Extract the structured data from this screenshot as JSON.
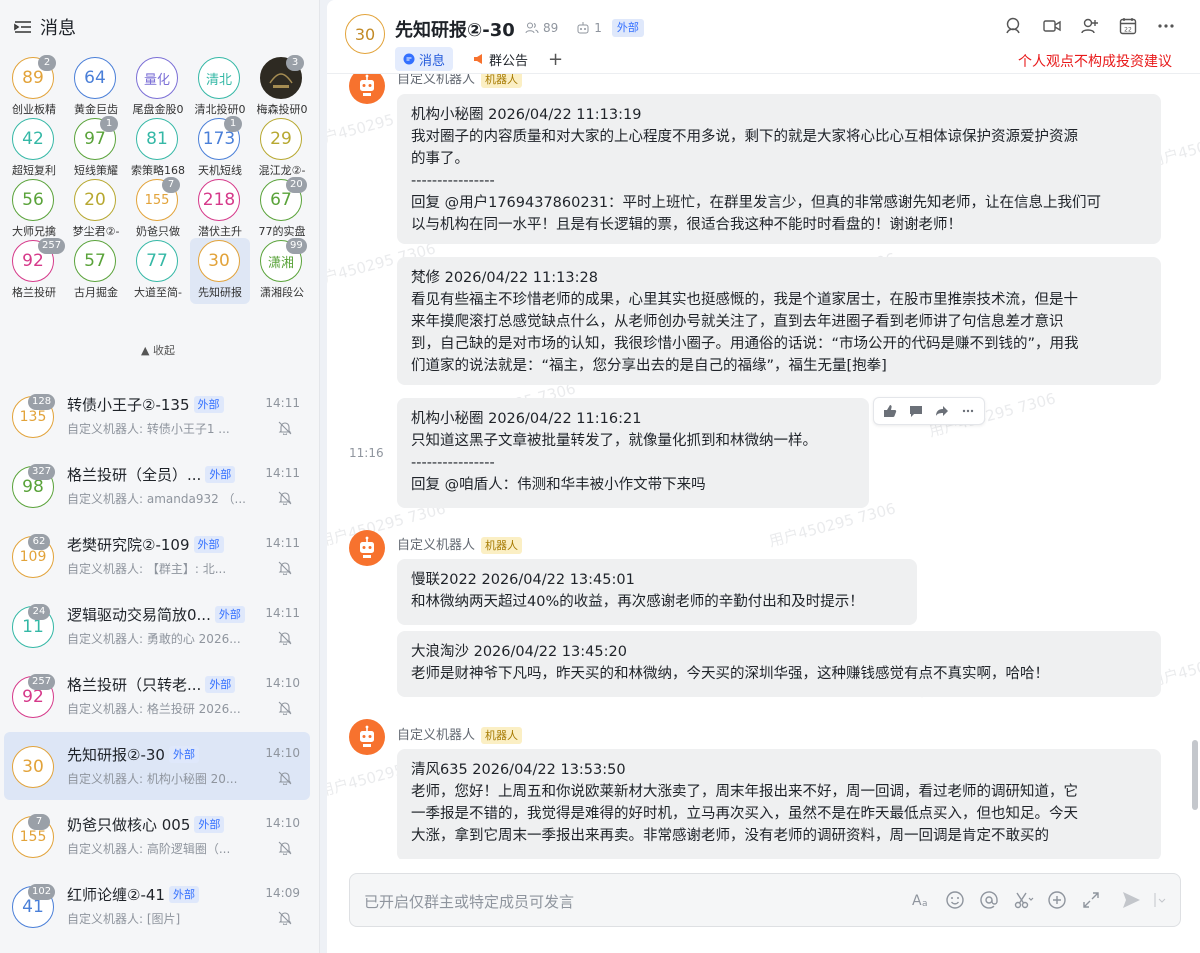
{
  "sidebar": {
    "title": "消息",
    "grid": [
      {
        "text": "89",
        "label": "创业板精",
        "badge": "2",
        "color": "#e2a33a",
        "small": false
      },
      {
        "text": "64",
        "label": "黄金巨齿",
        "badge": "",
        "color": "#4a7fd8",
        "small": false
      },
      {
        "text": "量化",
        "label": "尾盘金股0",
        "badge": "",
        "color": "#7b6fd6",
        "small": true
      },
      {
        "text": "清北",
        "label": "清北投研0",
        "badge": "",
        "color": "#35b8a6",
        "small": true
      },
      {
        "text": "",
        "label": "梅森投研0",
        "badge": "3",
        "color": "#2e2a22",
        "small": false
      },
      {
        "text": "42",
        "label": "超短复利",
        "badge": "",
        "color": "#35b8a6",
        "small": false
      },
      {
        "text": "97",
        "label": "短线策耀",
        "badge": "1",
        "color": "#5aa33a",
        "small": false
      },
      {
        "text": "81",
        "label": "索策略168",
        "badge": "",
        "color": "#35b8a6",
        "small": false
      },
      {
        "text": "173",
        "label": "天机短线",
        "badge": "1",
        "color": "#4a7fd8",
        "small": false
      },
      {
        "text": "29",
        "label": "混江龙②-",
        "badge": "",
        "color": "#b7a830",
        "small": false
      },
      {
        "text": "56",
        "label": "大师兄擒",
        "badge": "",
        "color": "#5aa33a",
        "small": false
      },
      {
        "text": "20",
        "label": "梦尘君②-",
        "badge": "",
        "color": "#b7a830",
        "small": false
      },
      {
        "text": "155",
        "label": "奶爸只做",
        "badge": "7",
        "color": "#e2a33a",
        "small": true
      },
      {
        "text": "218",
        "label": "潜伏主升",
        "badge": "",
        "color": "#d6398a",
        "small": false
      },
      {
        "text": "67",
        "label": "77的实盘",
        "badge": "20",
        "color": "#5aa33a",
        "small": false
      },
      {
        "text": "92",
        "label": "格兰投研",
        "badge": "257",
        "color": "#d6398a",
        "small": false
      },
      {
        "text": "57",
        "label": "古月掘金",
        "badge": "",
        "color": "#5aa33a",
        "small": false
      },
      {
        "text": "77",
        "label": "大道至简-",
        "badge": "",
        "color": "#35b8a6",
        "small": false
      },
      {
        "text": "30",
        "label": "先知研报",
        "badge": "",
        "color": "#e2a33a",
        "small": false
      },
      {
        "text": "潇湘",
        "label": "潇湘段公",
        "badge": "99",
        "color": "#5aa33a",
        "small": true
      }
    ],
    "collapse_label": "▲ 收起",
    "chats": [
      {
        "avatar": "135",
        "badge": "128",
        "color": "#e2a33a",
        "name": "转债小王子②-135",
        "tag": "外部",
        "time": "14:11",
        "preview": "自定义机器人: 转债小王子1 ...",
        "small": true
      },
      {
        "avatar": "98",
        "badge": "327",
        "color": "#5aa33a",
        "name": "格兰投研（全员）...",
        "tag": "外部",
        "time": "14:11",
        "preview": "自定义机器人: amanda932 （...",
        "small": false
      },
      {
        "avatar": "109",
        "badge": "62",
        "color": "#e2a33a",
        "name": "老樊研究院②-109",
        "tag": "外部",
        "time": "14:11",
        "preview": "自定义机器人: 【群主】: 北...",
        "small": true
      },
      {
        "avatar": "11",
        "badge": "24",
        "color": "#35b8a6",
        "name": "逻辑驱动交易简放0...",
        "tag": "外部",
        "time": "14:11",
        "preview": "自定义机器人: 勇敢的心 2026...",
        "small": false
      },
      {
        "avatar": "92",
        "badge": "257",
        "color": "#d6398a",
        "name": "格兰投研（只转老...",
        "tag": "外部",
        "time": "14:10",
        "preview": "自定义机器人: 格兰投研 2026...",
        "small": false
      },
      {
        "avatar": "30",
        "badge": "",
        "color": "#e2a33a",
        "name": "先知研报②-30",
        "tag": "外部",
        "time": "14:10",
        "preview": "自定义机器人: 机构小秘圈 20...",
        "small": false
      },
      {
        "avatar": "155",
        "badge": "7",
        "color": "#e2a33a",
        "name": "奶爸只做核心 005",
        "tag": "外部",
        "time": "14:10",
        "preview": "自定义机器人: 高阶逻辑圈（...",
        "small": true
      },
      {
        "avatar": "41",
        "badge": "102",
        "color": "#4a7fd8",
        "name": "红师论缠②-41",
        "tag": "外部",
        "time": "14:09",
        "preview": "自定义机器人: [图片]",
        "small": false
      }
    ]
  },
  "header": {
    "avatar": "30",
    "title": "先知研报②-30",
    "members": "89",
    "bots": "1",
    "external_tag": "外部",
    "tabs": [
      "消息",
      "群公告"
    ],
    "disclaimer": "个人观点不构成投资建议"
  },
  "messages": {
    "sender_name": "自定义机器人",
    "bot_tag": "机器人",
    "side_time": "11:16",
    "bubbles": [
      {
        "lines": [
          "机构小秘圈 2026/04/22 11:13:19",
          "我对圈子的内容质量和对大家的上心程度不用多说，剩下的就是大家将心比心互相体谅保护资源爱护资源",
          "的事了。",
          "----------------",
          "回复 @用户1769437860231：平时上班忙，在群里发言少，但真的非常感谢先知老师，让在信息上我们可",
          "以与机构在同一水平！且是有长逻辑的票，很适合我这种不能时时看盘的！谢谢老师！"
        ]
      },
      {
        "lines": [
          "梵修 2026/04/22 11:13:28",
          "看见有些福主不珍惜老师的成果，心里其实也挺感慨的，我是个道家居士，在股市里推崇技术流，但是十",
          "来年摸爬滚打总感觉缺点什么，从老师创办号就关注了，直到去年进圈子看到老师讲了句信息差才意识",
          "到，自己缺的是对市场的认知，我很珍惜小圈子。用通俗的话说：“市场公开的代码是赚不到钱的”，用我",
          "们道家的说法就是：“福主，您分享出去的是自己的福缘”，福生无量[抱拳]"
        ]
      },
      {
        "lines": [
          "机构小秘圈 2026/04/22 11:16:21",
          "只知道这黑子文章被批量转发了，就像量化抓到和林微纳一样。",
          "----------------",
          "回复 @咱盾人：伟测和华丰被小作文带下来吗"
        ]
      },
      {
        "lines": [
          "慢联2022 2026/04/22 13:45:01",
          "和林微纳两天超过40%的收益，再次感谢老师的辛勤付出和及时提示！"
        ]
      },
      {
        "lines": [
          "大浪淘沙 2026/04/22 13:45:20",
          "老师是财神爷下凡吗，昨天买的和林微纳，今天买的深圳华强，这种赚钱感觉有点不真实啊，哈哈！"
        ]
      },
      {
        "lines": [
          "清风635 2026/04/22 13:53:50",
          "老师，您好！上周五和你说欧莱新材大涨卖了，周末年报出来不好，周一回调，看过老师的调研知道，它",
          "一季报是不错的，我觉得是难得的好时机，立马再次买入，虽然不是在昨天最低点买入，但也知足。今天",
          "大涨，拿到它周末一季报出来再卖。非常感谢老师，没有老师的调研资料，周一回调是肯定不敢买的"
        ]
      }
    ],
    "watermark": "用户450295 7306"
  },
  "composer": {
    "placeholder": "已开启仅群主或特定成员可发言"
  },
  "colors": {
    "accent": "#3370ff",
    "bot": "#f7722e",
    "disclaimer": "#e8191a"
  }
}
